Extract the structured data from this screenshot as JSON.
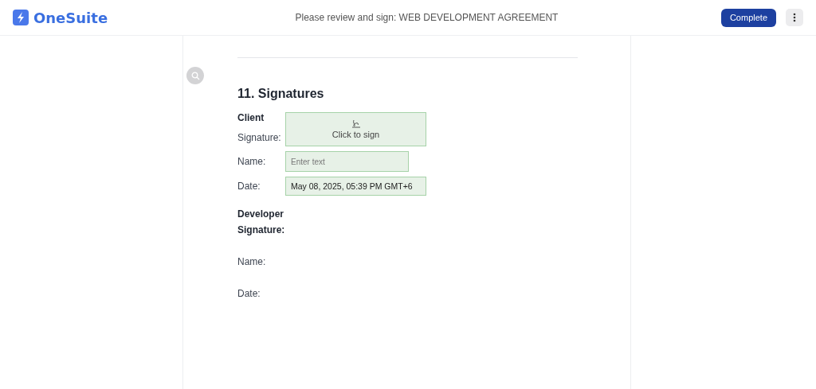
{
  "header": {
    "logo": "OneSuite",
    "title": "Please review and sign: WEB DEVELOPMENT AGREEMENT",
    "complete_button": "Complete"
  },
  "section": {
    "heading": "11. Signatures",
    "parties": [
      {
        "name": "Client",
        "fields": [
          {
            "kind": "signature",
            "label": "Signature:",
            "action": "Click to sign"
          },
          {
            "kind": "text",
            "label": "Name:",
            "placeholder": "Enter text"
          },
          {
            "kind": "date",
            "label": "Date:",
            "value": "May 08, 2025, 05:39 PM GMT+6"
          }
        ]
      },
      {
        "name": "Developer",
        "fields": [
          {
            "kind": "signature-label",
            "label": "Signature:"
          },
          {
            "kind": "plain",
            "label": "Name:"
          },
          {
            "kind": "plain",
            "label": "Date:"
          }
        ]
      }
    ]
  }
}
